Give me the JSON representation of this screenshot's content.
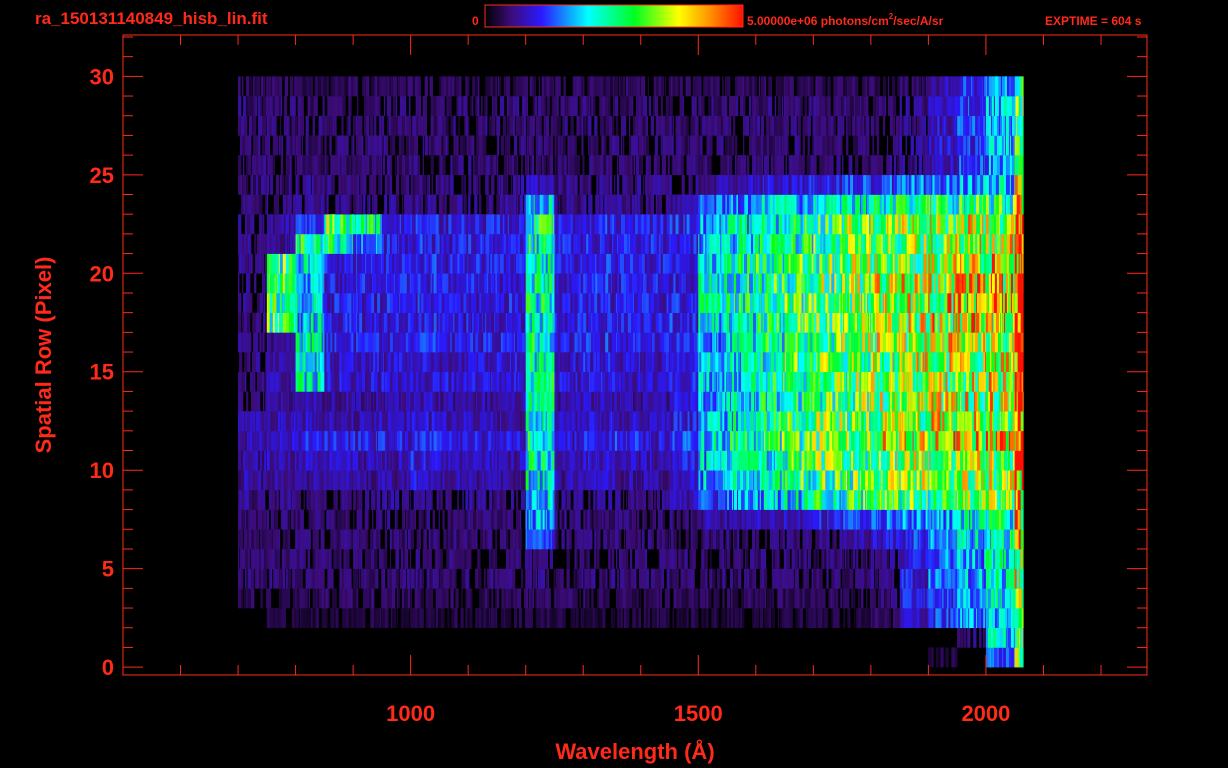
{
  "header": {
    "filename": "ra_150131140849_hisb_lin.fit",
    "colorbar_min_label": "0",
    "colorbar_max_label": "5.00000e+06 photons/cm",
    "colorbar_unit_sup": "2",
    "colorbar_unit_rest": "/sec/A/sr",
    "exptime": "EXPTIME = 604 s"
  },
  "colors": {
    "axis": "#ff2a1a",
    "background": "#000000"
  },
  "chart_data": {
    "type": "heatmap",
    "title": "ra_150131140849_hisb_lin.fit",
    "xlabel": "Wavelength (Å)",
    "ylabel": "Spatial Row (Pixel)",
    "xlim": [
      500,
      2280
    ],
    "ylim": [
      -0.4,
      32.1
    ],
    "x_major_ticks": [
      1000,
      1500,
      2000
    ],
    "x_tick_labels": [
      "1000",
      "1500",
      "2000"
    ],
    "x_minor_step": 100,
    "y_major_ticks": [
      0,
      5,
      10,
      15,
      20,
      25,
      30
    ],
    "y_tick_labels": [
      "0",
      "5",
      "10",
      "15",
      "20",
      "25",
      "30"
    ],
    "y_minor_step": 1,
    "z_range": [
      0,
      5.0
    ],
    "z_unit": "1e6 photons/cm^2/sec/A/sr",
    "colormap": [
      [
        0.0,
        "#000000"
      ],
      [
        0.1,
        "#3c0c78"
      ],
      [
        0.22,
        "#2a1aff"
      ],
      [
        0.4,
        "#00ffff"
      ],
      [
        0.58,
        "#00ff20"
      ],
      [
        0.75,
        "#ffff00"
      ],
      [
        0.88,
        "#ff8a00"
      ],
      [
        1.0,
        "#ff1000"
      ]
    ],
    "bin_edges": [
      700,
      750,
      800,
      850,
      900,
      950,
      1000,
      1050,
      1100,
      1150,
      1200,
      1250,
      1300,
      1350,
      1400,
      1450,
      1500,
      1550,
      1600,
      1650,
      1700,
      1750,
      1800,
      1850,
      1900,
      1950,
      2000,
      2050,
      2065
    ],
    "rows": [
      [
        0,
        0,
        0,
        0,
        0,
        0,
        0,
        0,
        0,
        0,
        0,
        0,
        0,
        0,
        0,
        0,
        0,
        0,
        0,
        0,
        0,
        0,
        0,
        0,
        0.3,
        0,
        1.5,
        3
      ],
      [
        0,
        0,
        0,
        0,
        0,
        0,
        0,
        0,
        0,
        0,
        0,
        0,
        0,
        0,
        0,
        0,
        0,
        0,
        0,
        0,
        0,
        0,
        0,
        0,
        0,
        0.5,
        2,
        3
      ],
      [
        0,
        0.3,
        0.3,
        0.3,
        0.3,
        0.3,
        0.3,
        0.3,
        0.3,
        0.3,
        0.3,
        0.3,
        0.3,
        0.3,
        0.3,
        0.3,
        0.3,
        0.3,
        0.3,
        0.3,
        0.3,
        0.3,
        0.4,
        0.8,
        1.2,
        1.5,
        2,
        3
      ],
      [
        0.4,
        0.4,
        0.4,
        0.4,
        0.4,
        0.4,
        0.4,
        0.4,
        0.4,
        0.4,
        0.4,
        0.4,
        0.4,
        0.4,
        0.4,
        0.4,
        0.4,
        0.4,
        0.4,
        0.4,
        0.4,
        0.4,
        0.5,
        1,
        1.3,
        1.6,
        2.2,
        3.5
      ],
      [
        0.5,
        0.5,
        0.5,
        0.5,
        0.5,
        0.5,
        0.5,
        0.5,
        0.5,
        0.5,
        0.6,
        0.5,
        0.5,
        0.5,
        0.5,
        0.5,
        0.5,
        0.5,
        0.5,
        0.5,
        0.5,
        0.5,
        0.6,
        1,
        1.4,
        1.8,
        2.2,
        3.5
      ],
      [
        0.5,
        0.5,
        0.5,
        0.5,
        0.5,
        0.5,
        0.5,
        0.5,
        0.5,
        0.5,
        0.6,
        0.5,
        0.5,
        0.5,
        0.5,
        0.5,
        0.5,
        0.5,
        0.5,
        0.5,
        0.5,
        0.5,
        0.6,
        1,
        1.4,
        1.8,
        2.2,
        3.5
      ],
      [
        0.5,
        0.5,
        0.5,
        0.5,
        0.5,
        0.5,
        0.5,
        0.5,
        0.5,
        0.5,
        1.3,
        0.5,
        0.5,
        0.5,
        0.5,
        0.5,
        0.5,
        0.5,
        0.5,
        0.5,
        0.6,
        0.7,
        0.9,
        1.2,
        1.5,
        2,
        2.4,
        3.8
      ],
      [
        0.5,
        0.5,
        0.5,
        0.5,
        0.5,
        0.5,
        0.5,
        0.5,
        0.5,
        0.5,
        1.8,
        0.5,
        0.5,
        0.5,
        0.5,
        0.5,
        0.7,
        0.7,
        0.8,
        0.9,
        1,
        1.2,
        1.4,
        1.6,
        1.8,
        2.2,
        2.5,
        4
      ],
      [
        0.6,
        0.6,
        0.6,
        0.6,
        0.6,
        0.6,
        0.6,
        0.6,
        0.6,
        0.6,
        2,
        0.6,
        0.6,
        0.6,
        0.6,
        0.8,
        1.2,
        1.6,
        1.9,
        2.2,
        2.5,
        2.7,
        2.8,
        2.9,
        3,
        3,
        3.1,
        4.5
      ],
      [
        0.7,
        0.7,
        0.7,
        0.7,
        0.7,
        0.7,
        0.9,
        0.7,
        0.7,
        0.7,
        2.3,
        0.7,
        0.8,
        0.7,
        0.7,
        0.9,
        1.8,
        2.1,
        2.4,
        2.7,
        2.9,
        3,
        3.1,
        3.2,
        3.3,
        3.3,
        3.4,
        4.8
      ],
      [
        0.7,
        0.8,
        0.8,
        0.8,
        0.8,
        0.8,
        1,
        0.8,
        0.8,
        0.8,
        2.4,
        0.8,
        0.9,
        0.8,
        0.8,
        1,
        1.9,
        2.2,
        2.5,
        2.8,
        3,
        3.1,
        3.2,
        3.3,
        3.4,
        3.5,
        3.5,
        5
      ],
      [
        0.8,
        0.9,
        1,
        1,
        1,
        1,
        1.1,
        1,
        1,
        0.9,
        2.6,
        0.9,
        1,
        1.1,
        0.9,
        1.2,
        2.2,
        2.5,
        2.8,
        3,
        3.2,
        3.4,
        3.6,
        3.8,
        4,
        4.2,
        4.1,
        5
      ],
      [
        0.7,
        0.8,
        0.8,
        0.8,
        0.8,
        0.8,
        0.9,
        0.8,
        0.8,
        0.8,
        2.4,
        0.8,
        0.9,
        0.8,
        0.8,
        1,
        2,
        2.3,
        2.6,
        2.9,
        3.1,
        3.2,
        3.3,
        3.5,
        3.6,
        3.7,
        3.7,
        5
      ],
      [
        0.6,
        0.7,
        0.7,
        0.7,
        0.7,
        0.7,
        0.8,
        0.7,
        0.7,
        0.7,
        2.3,
        0.7,
        0.8,
        0.7,
        0.7,
        0.9,
        1.7,
        2,
        2.4,
        2.7,
        2.9,
        3.1,
        3.3,
        3.4,
        3.5,
        3.6,
        3.6,
        5
      ],
      [
        0.6,
        0.7,
        2.2,
        0.9,
        0.9,
        0.9,
        1,
        0.9,
        0.9,
        0.9,
        2.4,
        0.9,
        1,
        0.9,
        0.9,
        1,
        1.8,
        2.1,
        2.5,
        2.8,
        3,
        3.2,
        3.4,
        3.5,
        3.6,
        3.7,
        3.7,
        5
      ],
      [
        0.6,
        0.7,
        2.2,
        0.9,
        0.9,
        0.9,
        1,
        0.9,
        0.9,
        0.9,
        2.4,
        0.9,
        1,
        0.9,
        0.9,
        1,
        1.8,
        2.1,
        2.5,
        2.8,
        3,
        3.2,
        3.4,
        3.5,
        3.6,
        3.7,
        3.7,
        5
      ],
      [
        0.6,
        0.7,
        2.3,
        1,
        1,
        1,
        1.1,
        1,
        1,
        1,
        2.4,
        1,
        1.1,
        1,
        1,
        1.1,
        1.8,
        2.1,
        2.5,
        2.8,
        3,
        3.2,
        3.4,
        3.5,
        3.6,
        3.7,
        3.7,
        5
      ],
      [
        0.6,
        2.8,
        2,
        1,
        1,
        1,
        1.1,
        1,
        1,
        1,
        2.4,
        1,
        1.1,
        1,
        1,
        1.1,
        2,
        2.3,
        2.6,
        2.9,
        3.1,
        3.3,
        3.5,
        3.6,
        3.8,
        3.9,
        4,
        5
      ],
      [
        0.6,
        3,
        2,
        1,
        1,
        1,
        1.1,
        1,
        1,
        1,
        2.4,
        1,
        1.1,
        1,
        1,
        1.1,
        2.2,
        2.5,
        2.7,
        2.9,
        3.1,
        3.3,
        3.5,
        3.6,
        3.8,
        4,
        4.2,
        5
      ],
      [
        0.6,
        3,
        2,
        1,
        1,
        1,
        1.1,
        1,
        1,
        1,
        2.4,
        1,
        1.1,
        1,
        1,
        1.1,
        2.2,
        2.5,
        2.7,
        2.9,
        3.1,
        3.3,
        3.5,
        3.6,
        3.8,
        4,
        4.2,
        5
      ],
      [
        0.6,
        2.8,
        2.2,
        1,
        1,
        1,
        1.1,
        1,
        1,
        1,
        2.4,
        1,
        1.1,
        1,
        1,
        1.1,
        2.1,
        2.4,
        2.6,
        2.8,
        3,
        3.2,
        3.4,
        3.5,
        3.6,
        3.7,
        3.8,
        5
      ],
      [
        0.6,
        0.7,
        2.6,
        2.6,
        1.5,
        1,
        1.1,
        1,
        1,
        1,
        2.5,
        1,
        1.1,
        1,
        1,
        1.1,
        1.9,
        2.2,
        2.5,
        2.7,
        2.9,
        3.1,
        3.3,
        3.4,
        3.5,
        3.6,
        3.6,
        5
      ],
      [
        0.6,
        0.7,
        1.2,
        3,
        2.4,
        1,
        1.1,
        1,
        1,
        1,
        2.5,
        1,
        1.1,
        1,
        1,
        1.1,
        1.9,
        2.2,
        2.5,
        2.7,
        2.9,
        3.1,
        3.3,
        3.4,
        3.5,
        3.6,
        3.6,
        5
      ],
      [
        0.5,
        0.6,
        0.6,
        0.6,
        0.6,
        0.6,
        0.6,
        0.6,
        0.6,
        0.6,
        2.2,
        0.6,
        0.6,
        0.6,
        0.6,
        0.7,
        1.4,
        1.6,
        1.8,
        2,
        2.2,
        2.3,
        2.4,
        2.5,
        2.6,
        2.7,
        2.8,
        4
      ],
      [
        0.5,
        0.5,
        0.6,
        0.6,
        0.6,
        0.6,
        0.6,
        0.6,
        0.6,
        0.6,
        0.8,
        0.6,
        0.6,
        0.6,
        0.6,
        0.6,
        0.7,
        0.8,
        0.9,
        1,
        1.1,
        1.2,
        1.3,
        1.4,
        1.5,
        1.7,
        2,
        3.5
      ],
      [
        0.5,
        0.5,
        0.5,
        0.5,
        0.5,
        0.5,
        0.5,
        0.5,
        0.5,
        0.5,
        0.5,
        0.5,
        0.5,
        0.5,
        0.5,
        0.5,
        0.5,
        0.5,
        0.5,
        0.5,
        0.5,
        0.5,
        0.5,
        0.6,
        0.9,
        1.2,
        1.8,
        3
      ],
      [
        0.5,
        0.5,
        0.5,
        0.5,
        0.5,
        0.5,
        0.5,
        0.5,
        0.5,
        0.5,
        0.5,
        0.5,
        0.5,
        0.5,
        0.5,
        0.5,
        0.5,
        0.5,
        0.5,
        0.5,
        0.5,
        0.5,
        0.5,
        0.6,
        0.9,
        1.2,
        1.8,
        3
      ],
      [
        0.5,
        0.5,
        0.5,
        0.5,
        0.5,
        0.5,
        0.5,
        0.5,
        0.5,
        0.5,
        0.5,
        0.5,
        0.5,
        0.5,
        0.5,
        0.5,
        0.5,
        0.5,
        0.5,
        0.5,
        0.5,
        0.5,
        0.5,
        0.6,
        0.9,
        1.2,
        1.8,
        3
      ],
      [
        0.5,
        0.5,
        0.5,
        0.5,
        0.5,
        0.5,
        0.5,
        0.5,
        0.5,
        0.5,
        0.5,
        0.5,
        0.5,
        0.5,
        0.5,
        0.5,
        0.5,
        0.5,
        0.5,
        0.5,
        0.5,
        0.5,
        0.5,
        0.6,
        0.9,
        1.2,
        1.8,
        3
      ],
      [
        0.4,
        0.4,
        0.4,
        0.4,
        0.4,
        0.4,
        0.4,
        0.4,
        0.4,
        0.4,
        0.4,
        0.4,
        0.4,
        0.4,
        0.4,
        0.4,
        0.4,
        0.4,
        0.4,
        0.4,
        0.4,
        0.4,
        0.4,
        0.5,
        0.8,
        1.1,
        1.5,
        3
      ]
    ]
  }
}
